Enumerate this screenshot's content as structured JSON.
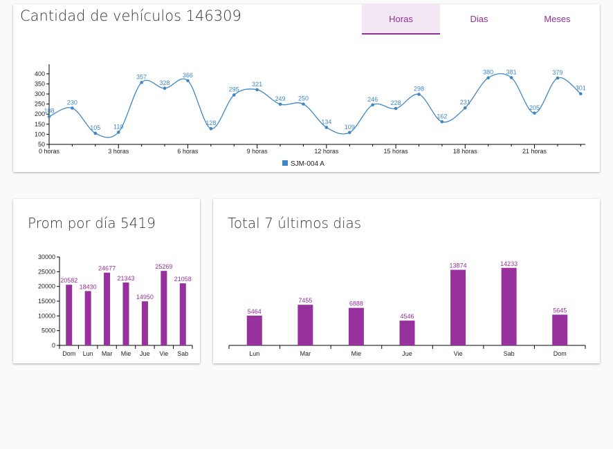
{
  "hourly_card": {
    "title": "Cantidad de vehículos 146309",
    "tabs": [
      {
        "label": "Horas",
        "active": true
      },
      {
        "label": "Dias",
        "active": false
      },
      {
        "label": "Meses",
        "active": false
      }
    ]
  },
  "daily_avg_card": {
    "title": "Prom por día 5419"
  },
  "last7_card": {
    "title": "Total 7 últimos dias"
  },
  "colors": {
    "line": "#3f87c3",
    "bar": "#97319d",
    "tab_text": "#8e3192",
    "tab_active_bg": "#f3e7f4"
  },
  "chart_data": [
    {
      "type": "line",
      "x": [
        0,
        1,
        2,
        3,
        4,
        5,
        6,
        7,
        8,
        9,
        10,
        11,
        12,
        13,
        14,
        15,
        16,
        17,
        18,
        19,
        20,
        21,
        22,
        23
      ],
      "values": [
        188,
        230,
        105,
        110,
        357,
        328,
        366,
        128,
        295,
        321,
        249,
        250,
        134,
        109,
        246,
        228,
        298,
        162,
        231,
        380,
        381,
        205,
        379,
        301
      ],
      "x_ticks": [
        0,
        3,
        6,
        9,
        12,
        15,
        18,
        21
      ],
      "x_tick_labels": [
        "0 horas",
        "3 horas",
        "6 horas",
        "9 horas",
        "12 horas",
        "15 horas",
        "18 horas",
        "21 horas"
      ],
      "y_ticks": [
        50,
        100,
        150,
        200,
        250,
        300,
        350,
        400
      ],
      "ylim": [
        50,
        420
      ],
      "xlim": [
        0,
        23.2
      ],
      "series": [
        {
          "name": "SJM-004 A"
        }
      ],
      "legend": "bottom-center",
      "grid": false
    },
    {
      "type": "bar",
      "categories": [
        "Dom",
        "Lun",
        "Mar",
        "Mie",
        "Jue",
        "Vie",
        "Sab"
      ],
      "values": [
        20582,
        18430,
        24677,
        21343,
        14950,
        25269,
        21058
      ],
      "y_ticks": [
        0,
        5000,
        10000,
        15000,
        20000,
        25000,
        30000
      ],
      "ylim": [
        0,
        30000
      ],
      "grid": false
    },
    {
      "type": "bar",
      "categories": [
        "Lun",
        "Mar",
        "Mie",
        "Jue",
        "Vie",
        "Sab",
        "Dom"
      ],
      "values": [
        5464,
        7455,
        6888,
        4546,
        13874,
        14233,
        5645
      ],
      "ylim": [
        0,
        17500
      ],
      "grid": false
    }
  ]
}
